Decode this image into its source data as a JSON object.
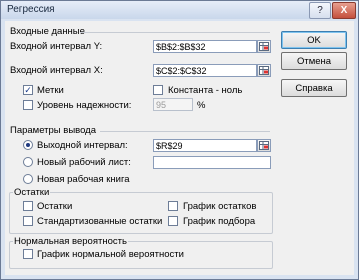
{
  "window": {
    "title": "Регрессия",
    "help_glyph": "?",
    "close_glyph": "X"
  },
  "input": {
    "section_title": "Входные данные",
    "y_range_label": "Входной интервал Y:",
    "y_range_value": "$B$2:$B$32",
    "x_range_label": "Входной интервал X:",
    "x_range_value": "$C$2:$C$32",
    "labels_label": "Метки",
    "labels_checked": true,
    "constant_zero_label": "Константа - ноль",
    "constant_zero_checked": false,
    "confidence_label": "Уровень надежности:",
    "confidence_checked": false,
    "confidence_value": "95",
    "percent_sign": "%"
  },
  "output": {
    "section_title": "Параметры вывода",
    "output_range_label": "Выходной интервал:",
    "output_range_value": "$R$29",
    "new_sheet_label": "Новый рабочий лист:",
    "new_sheet_value": "",
    "new_workbook_label": "Новая рабочая книга",
    "selected": "output_range"
  },
  "residuals": {
    "group_title": "Остатки",
    "residuals_label": "Остатки",
    "residual_plots_label": "График остатков",
    "standardized_label": "Стандартизованные остатки",
    "line_fit_label": "График подбора"
  },
  "normal": {
    "group_title": "Нормальная вероятность",
    "plot_label": "График нормальной вероятности"
  },
  "buttons": {
    "ok": "OK",
    "cancel": "Отмена",
    "help": "Справка"
  },
  "colors": {
    "selected_radio": "#203b80",
    "ok_focus": "#3c7fb1",
    "titlebar": "#c9d7eb"
  }
}
